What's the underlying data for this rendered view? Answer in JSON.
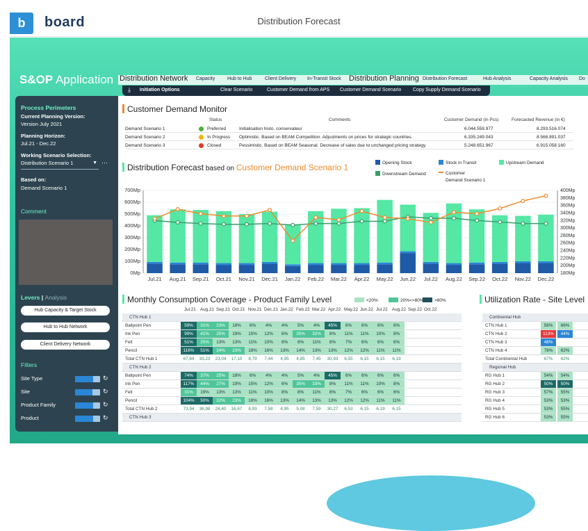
{
  "brand": {
    "logo_letter": "b",
    "logo_text": "board"
  },
  "window_title": "Distribution Forecast",
  "app_title": {
    "part1": "S&OP",
    "part2": " Application"
  },
  "tabs": [
    {
      "label": "Distribution Network",
      "big": true
    },
    {
      "label": "Capacity"
    },
    {
      "label": "Hub to Hub"
    },
    {
      "label": "Client Delivery"
    },
    {
      "label": "In-Transit Stock"
    },
    {
      "label": "Distribution Planning",
      "big": true
    },
    {
      "label": "Distribution Forecast"
    },
    {
      "label": "Hub Analysis"
    },
    {
      "label": "Capacity Analysis"
    },
    {
      "label": "Do"
    }
  ],
  "subtabs": [
    "Initiation Options",
    "Clear Scenario",
    "Customer Demand from APS",
    "Customer Demand Scenario",
    "Copy Supply Demand Scenario"
  ],
  "sidebar": {
    "process_title": "Process Perimeters",
    "cpv_label": "Current Planning Version:",
    "cpv_value": "Version July 2021",
    "ph_label": "Planning Horizon:",
    "ph_value": "Jul.21 - Dec.22",
    "wss_label": "Working Scenario Selection:",
    "wss_value": "Distribution Scenario 1",
    "based_label": "Based on:",
    "based_value": "Demand Scenario 1",
    "comment_title": "Comment",
    "levers": "Levers",
    "sep": " | ",
    "analysis": "Analysis",
    "buttons": [
      "Hub Capacity & Target Stock",
      "Hub to Hub Network",
      "Client Delivery Network"
    ],
    "filters_title": "Filters",
    "filters": [
      {
        "label": "Site Type",
        "fill": 0.72
      },
      {
        "label": "Site",
        "fill": 0.7
      },
      {
        "label": "Product Family",
        "fill": 0.72
      },
      {
        "label": "Product",
        "fill": 0.72
      }
    ]
  },
  "cdm": {
    "title": "Customer Demand Monitor",
    "headers": {
      "status": "Status",
      "comments": "Comments",
      "demand": "Customer Demand (in Pcs)",
      "revenue": "Forecasted Revenue (in €)"
    },
    "rows": [
      {
        "name": "Demand Scenario 1",
        "status": "Preferred",
        "color": "#4caf3c",
        "comment": "Initialisation histo. conservateur",
        "demand": "6.044.559.977",
        "revenue": "8.293.516.074"
      },
      {
        "name": "Demand Scenario 2",
        "status": "In Progress",
        "color": "#f2b400",
        "comment": "Optimistic. Based on BEAM Competition. Adjustments on prices for strategic countries.",
        "demand": "6.335.249.043",
        "revenue": "8.568.891.037"
      },
      {
        "name": "Demand Scenario 3",
        "status": "Closed",
        "color": "#e03a2c",
        "comment": "Pessimistic. Based on BEAM Seasonal. Decrease of sales due to unchanged pricing strategy.",
        "demand": "5.248.651.967",
        "revenue": "6.915.058.160"
      }
    ]
  },
  "forecast": {
    "title_part1": "Distribution Forecast",
    "title_part2": " based on ",
    "title_part3": "Customer Demand Scenario 1",
    "legend": [
      {
        "label": "Opening Stock",
        "color": "#1f5aa6"
      },
      {
        "label": "Stock in Transit",
        "color": "#2a86d6"
      },
      {
        "label": "Upstream Demand",
        "color": "#55e7a4"
      },
      {
        "label": "Downstream Demand",
        "color": "#3a9e6c"
      },
      {
        "label": "Customer",
        "color": "#ef8a2c"
      },
      {
        "label": "Demand Scenario 1",
        "color": "#ef8a2c"
      }
    ]
  },
  "chart_data": {
    "type": "bar",
    "categories": [
      "Jul.21",
      "Aug.21",
      "Sep.21",
      "Oct.21",
      "Nov.21",
      "Dec.21",
      "Jan.22",
      "Feb.22",
      "Mar.22",
      "Apr.22",
      "May.22",
      "Jun.22",
      "Jul.22",
      "Aug.22",
      "Sep.22",
      "Oct.22",
      "Nov.22",
      "Dec.22"
    ],
    "left_ticks": [
      "0Mp",
      "100Mp",
      "200Mp",
      "300Mp",
      "400Mp",
      "500Mp",
      "600Mp",
      "700Mp"
    ],
    "right_ticks": [
      "180Mp",
      "200Mp",
      "220Mp",
      "240Mp",
      "260Mp",
      "280Mp",
      "300Mp",
      "320Mp",
      "340Mp",
      "360Mp",
      "380Mp",
      "400Mp"
    ],
    "ylim": [
      0,
      700
    ],
    "y2lim": [
      180,
      400
    ],
    "series": [
      {
        "name": "Opening Stock",
        "values": [
          80,
          75,
          75,
          70,
          70,
          80,
          60,
          70,
          70,
          70,
          75,
          170,
          80,
          70,
          75,
          80,
          85,
          85
        ]
      },
      {
        "name": "Stock in Transit",
        "values": [
          15,
          15,
          15,
          15,
          15,
          15,
          15,
          15,
          15,
          15,
          15,
          15,
          15,
          15,
          15,
          15,
          15,
          15
        ]
      },
      {
        "name": "Upstream Demand",
        "values": [
          395,
          450,
          445,
          440,
          415,
          425,
          335,
          440,
          460,
          465,
          530,
          395,
          415,
          505,
          450,
          395,
          385,
          395
        ]
      },
      {
        "name": "Downstream Demand",
        "axis": "right",
        "values": [
          320,
          315,
          312,
          310,
          310,
          312,
          308,
          312,
          312,
          318,
          318,
          330,
          326,
          326,
          320,
          316,
          312,
          312
        ]
      },
      {
        "name": "Customer Demand Scenario 1",
        "axis": "right",
        "values": [
          325,
          350,
          338,
          332,
          332,
          348,
          266,
          328,
          322,
          345,
          328,
          325,
          315,
          342,
          338,
          352,
          372,
          386
        ]
      }
    ]
  },
  "mcc": {
    "title": "Monthly Consumption Coverage - Product Family Level",
    "legend": [
      "<20%",
      "20%<>80%",
      ">80%"
    ],
    "months": [
      "Jul.21",
      "Aug.21",
      "Sep.21",
      "Oct.21",
      "Nov.21",
      "Dec.21",
      "Jan.22",
      "Feb.22",
      "Mar.22",
      "Apr.22",
      "May.22",
      "Jun.22",
      "Jul.22",
      "Aug.22",
      "Sep.22",
      "Oct.22"
    ],
    "rows": [
      {
        "type": "grp",
        "name": "CTN Hub 1"
      },
      {
        "type": "row",
        "name": "Ballpoint Pen",
        "cells": [
          "59%",
          "31%",
          "23%",
          "18%",
          "6%",
          "4%",
          "4%",
          "5%",
          "4%",
          "45%",
          "6%",
          "6%",
          "6%",
          "6%"
        ]
      },
      {
        "type": "row",
        "name": "Ink Pen",
        "cells": [
          "99%",
          "41%",
          "25%",
          "19%",
          "15%",
          "12%",
          "6%",
          "35%",
          "32%",
          "8%",
          "11%",
          "11%",
          "10%",
          "8%"
        ]
      },
      {
        "type": "row",
        "name": "Felt",
        "cells": [
          "51%",
          "25%",
          "13%",
          "13%",
          "11%",
          "10%",
          "8%",
          "8%",
          "11%",
          "8%",
          "7%",
          "6%",
          "6%",
          "6%"
        ]
      },
      {
        "type": "row",
        "name": "Pencil",
        "cells": [
          "116%",
          "51%",
          "34%",
          "23%",
          "18%",
          "16%",
          "13%",
          "14%",
          "13%",
          "13%",
          "12%",
          "12%",
          "11%",
          "11%"
        ]
      },
      {
        "type": "tot",
        "name": "Total CTN Hub 1",
        "cells": [
          "67,84",
          "33,23",
          "23,04",
          "17,10",
          "8,79",
          "7,44",
          "4,95",
          "4,85",
          "7,45",
          "30,93",
          "6,55",
          "6,15",
          "6,15",
          "6,19"
        ]
      },
      {
        "type": "grp",
        "name": "CTN Hub 2"
      },
      {
        "type": "row",
        "name": "Ballpoint Pen",
        "cells": [
          "74%",
          "37%",
          "25%",
          "18%",
          "6%",
          "4%",
          "4%",
          "5%",
          "4%",
          "45%",
          "6%",
          "6%",
          "6%",
          "6%"
        ]
      },
      {
        "type": "row",
        "name": "Ink Pen",
        "cells": [
          "117%",
          "44%",
          "27%",
          "19%",
          "15%",
          "12%",
          "6%",
          "35%",
          "33%",
          "8%",
          "11%",
          "11%",
          "10%",
          "8%"
        ]
      },
      {
        "type": "row",
        "name": "Felt",
        "cells": [
          "31%",
          "19%",
          "13%",
          "13%",
          "11%",
          "10%",
          "8%",
          "8%",
          "11%",
          "8%",
          "7%",
          "6%",
          "6%",
          "6%"
        ]
      },
      {
        "type": "row",
        "name": "Pencil",
        "cells": [
          "104%",
          "50%",
          "32%",
          "23%",
          "18%",
          "16%",
          "13%",
          "14%",
          "13%",
          "13%",
          "12%",
          "12%",
          "11%",
          "11%"
        ]
      },
      {
        "type": "tot",
        "name": "Total CTN Hub 2",
        "cells": [
          "73,94",
          "36,98",
          "24,40",
          "16,67",
          "8,93",
          "7,58",
          "4,95",
          "5,08",
          "7,59",
          "30,27",
          "6,53",
          "6,15",
          "6,19",
          "6,15"
        ]
      },
      {
        "type": "grp",
        "name": "CTN Hub 3"
      }
    ]
  },
  "util": {
    "title": "Utilization Rate - Site Level",
    "rows": [
      {
        "type": "grp",
        "name": "Continental Hub"
      },
      {
        "type": "row",
        "name": "CTN Hub 1",
        "cells": [
          "56%",
          "66%"
        ]
      },
      {
        "type": "row",
        "name": "CTN Hub 2",
        "cells": [
          "113%",
          "44%"
        ]
      },
      {
        "type": "row",
        "name": "CTN Hub 3",
        "cells": [
          "48%",
          ""
        ]
      },
      {
        "type": "row",
        "name": "CTN Hub 4",
        "cells": [
          "78%",
          "62%"
        ]
      },
      {
        "type": "tot",
        "name": "Total Continental Hub",
        "cells": [
          "67%",
          "62%"
        ]
      },
      {
        "type": "grp",
        "name": "Regional Hub"
      },
      {
        "type": "row",
        "name": "RG Hub 1",
        "cells": [
          "54%",
          "54%"
        ]
      },
      {
        "type": "row",
        "name": "RG Hub 2",
        "cells": [
          "50%",
          "50%"
        ]
      },
      {
        "type": "row",
        "name": "RG Hub 3",
        "cells": [
          "57%",
          "55%"
        ]
      },
      {
        "type": "row",
        "name": "RG Hub 4",
        "cells": [
          "53%",
          "53%"
        ]
      },
      {
        "type": "row",
        "name": "RG Hub 5",
        "cells": [
          "53%",
          "55%"
        ]
      },
      {
        "type": "row",
        "name": "RG Hub 6",
        "cells": [
          "53%",
          "55%"
        ]
      }
    ]
  }
}
